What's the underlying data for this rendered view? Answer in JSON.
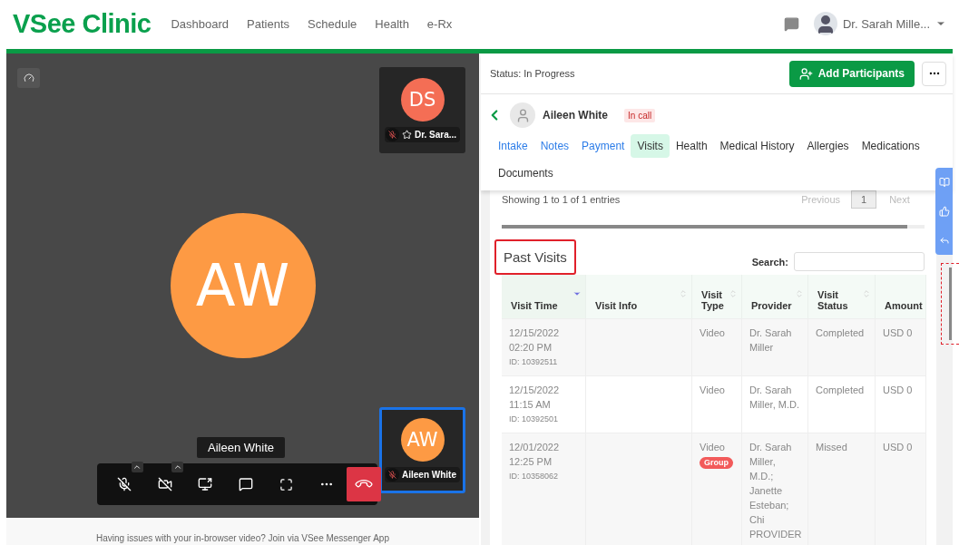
{
  "header": {
    "logo": "VSee Clinic",
    "nav": [
      "Dashboard",
      "Patients",
      "Schedule",
      "Health",
      "e-Rx"
    ],
    "user_name": "Dr. Sarah Mille..."
  },
  "call": {
    "main_tile": {
      "initials": "AW",
      "color": "#fd9a44",
      "name_tag": "Aileen White"
    },
    "tiles": [
      {
        "initials": "DS",
        "color": "#f46e55",
        "name": "Dr. Sara...",
        "muted": true,
        "starred": true,
        "active": false
      },
      {
        "initials": "AW",
        "color": "#fd9a44",
        "name": "Aileen White",
        "muted": true,
        "starred": false,
        "active": true
      }
    ],
    "controls": [
      {
        "kind": "mic",
        "has_menu": true
      },
      {
        "kind": "camera",
        "has_menu": true
      },
      {
        "kind": "share",
        "has_menu": false
      },
      {
        "kind": "chat",
        "has_menu": false
      },
      {
        "kind": "fullscreen",
        "has_menu": false
      },
      {
        "kind": "more",
        "has_menu": false
      },
      {
        "kind": "hangup",
        "has_menu": false
      }
    ],
    "footer": "Having issues with your in-browser video? Join via VSee Messenger App"
  },
  "panel": {
    "status": "Status: In Progress",
    "add_button": "Add Participants",
    "patient_name": "Aileen White",
    "badge": "In call",
    "tabs": [
      {
        "label": "Intake",
        "kind": "link",
        "selected": false
      },
      {
        "label": "Notes",
        "kind": "link",
        "selected": false
      },
      {
        "label": "Payment",
        "kind": "link",
        "selected": false
      },
      {
        "label": "Visits",
        "kind": "tab",
        "selected": true
      },
      {
        "label": "Health",
        "kind": "tab",
        "selected": false
      },
      {
        "label": "Medical History",
        "kind": "tab",
        "selected": false
      },
      {
        "label": "Allergies",
        "kind": "tab",
        "selected": false
      },
      {
        "label": "Medications",
        "kind": "tab",
        "selected": false
      },
      {
        "label": "Documents",
        "kind": "tab",
        "selected": false
      }
    ],
    "showing": "Showing 1 to 1 of 1 entries",
    "pagination": {
      "previous": "Previous",
      "page": "1",
      "next": "Next"
    },
    "section_title": "Past Visits",
    "search_label": "Search:",
    "columns": [
      {
        "label": "Visit Time",
        "sortable": true,
        "sorted": true
      },
      {
        "label": "Visit Info",
        "sortable": true,
        "sorted": false
      },
      {
        "label": "Visit Type",
        "sortable": true,
        "sorted": false
      },
      {
        "label": "Provider",
        "sortable": true,
        "sorted": false
      },
      {
        "label": "Visit Status",
        "sortable": true,
        "sorted": false
      },
      {
        "label": "Amount",
        "sortable": false,
        "sorted": false
      }
    ],
    "rows": [
      {
        "date": "12/15/2022",
        "time": "02:20 PM",
        "id": "ID: 10392511",
        "info": "",
        "type": "Video",
        "tag": "",
        "provider": "Dr. Sarah Miller",
        "status": "Completed",
        "amount": "USD 0"
      },
      {
        "date": "12/15/2022",
        "time": "11:15 AM",
        "id": "ID: 10392501",
        "info": "",
        "type": "Video",
        "tag": "",
        "provider": "Dr. Sarah Miller, M.D.",
        "status": "Completed",
        "amount": "USD 0"
      },
      {
        "date": "12/01/2022",
        "time": "12:25 PM",
        "id": "ID: 10358062",
        "info": "",
        "type": "Video",
        "tag": "Group",
        "provider": "Dr. Sarah Miller, M.D.; Janette Esteban; Chi PROVIDER",
        "status": "Missed",
        "amount": "USD 0"
      }
    ]
  }
}
